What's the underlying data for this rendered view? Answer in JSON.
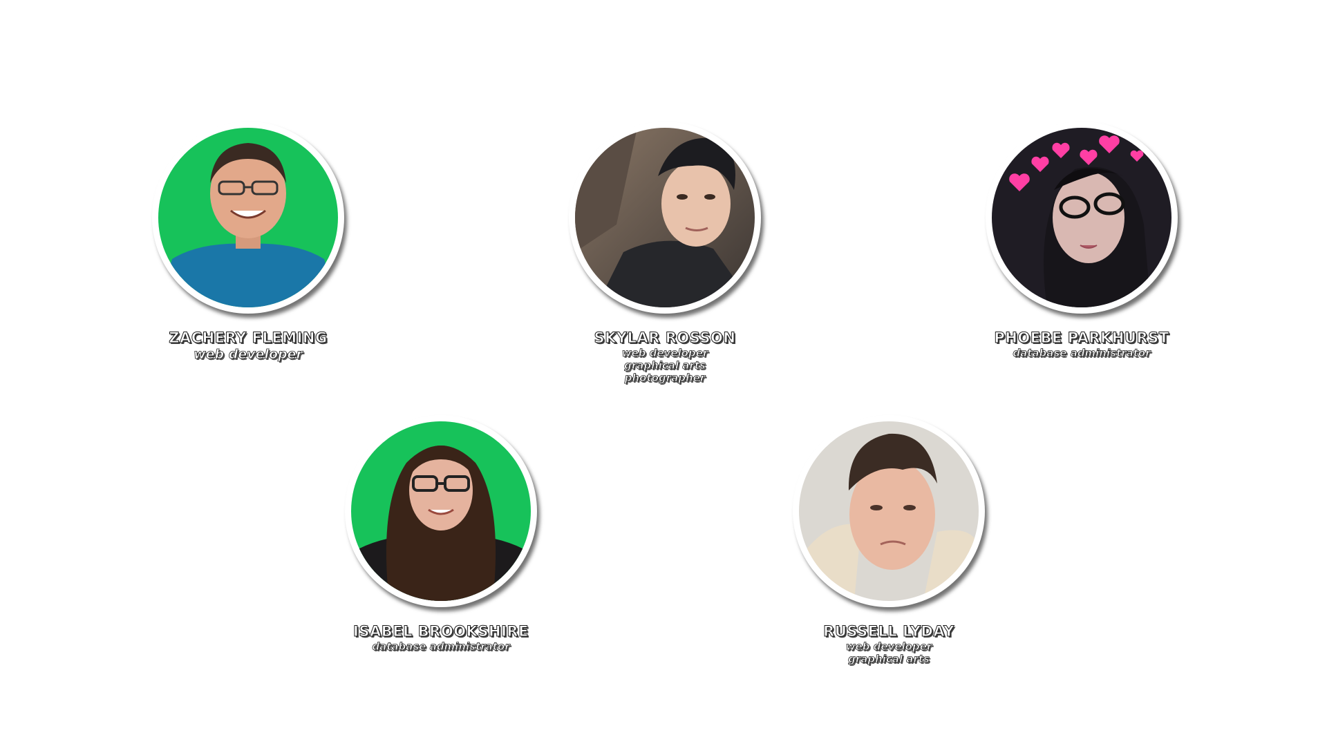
{
  "team": [
    {
      "name": "ZACHERY FLEMING",
      "roles": [
        "web developer"
      ],
      "photo_bg": "#1db954"
    },
    {
      "name": "SKYLAR ROSSON",
      "roles": [
        "web developer",
        "graphical arts",
        "photographer"
      ],
      "photo_bg": "#6b5a4e"
    },
    {
      "name": "PHOEBE PARKHURST",
      "roles": [
        "database administrator"
      ],
      "photo_bg": "#1f1c24"
    },
    {
      "name": "ISABEL BROOKSHIRE",
      "roles": [
        "database administrator"
      ],
      "photo_bg": "#1db954"
    },
    {
      "name": "RUSSELL LYDAY",
      "roles": [
        "web developer",
        "graphical arts"
      ],
      "photo_bg": "#d9d6d0"
    }
  ]
}
